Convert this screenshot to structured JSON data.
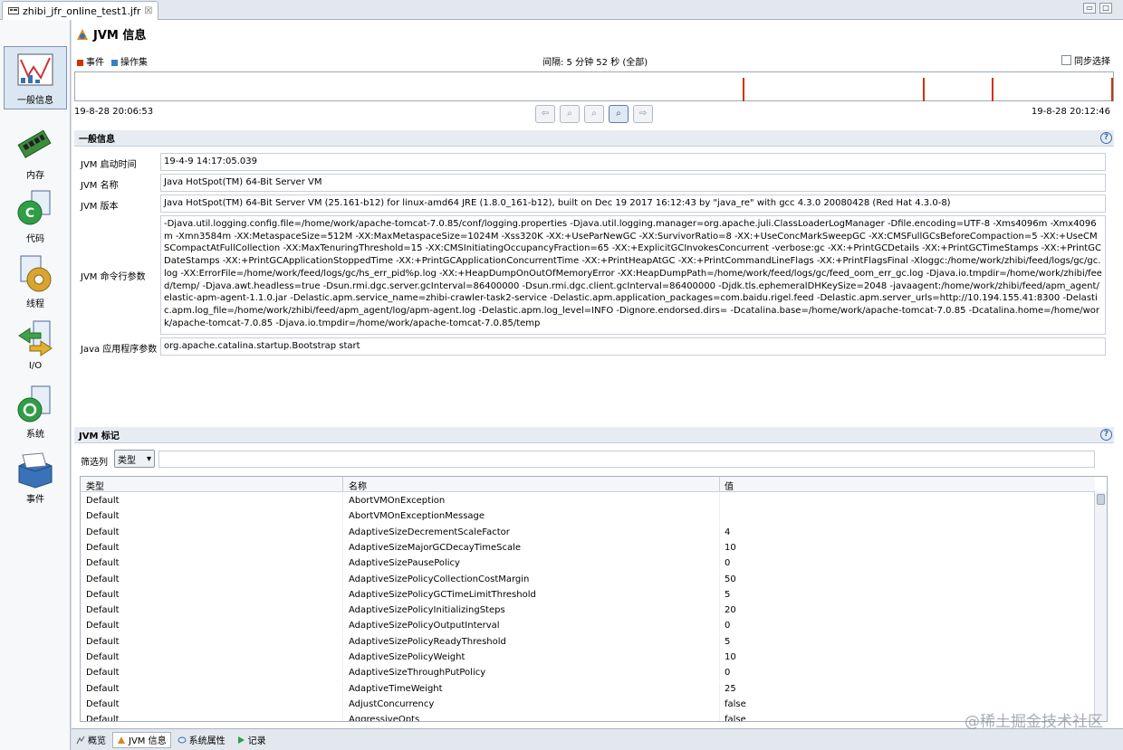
{
  "editor_tab": {
    "title": "zhibi_jfr_online_test1.jfr",
    "close": "☒"
  },
  "window_controls": {
    "minimize": "▭",
    "maximize": "□"
  },
  "sidebar": {
    "items": [
      {
        "label": "一般信息",
        "icon": "general-info-chart-icon",
        "active": true
      },
      {
        "label": "内存",
        "icon": "memory-chip-icon",
        "active": false
      },
      {
        "label": "代码",
        "icon": "code-icon",
        "active": false
      },
      {
        "label": "线程",
        "icon": "threads-gear-icon",
        "active": false
      },
      {
        "label": "I/O",
        "icon": "io-arrows-icon",
        "active": false
      },
      {
        "label": "系统",
        "icon": "system-icon",
        "active": false
      },
      {
        "label": "事件",
        "icon": "events-box-icon",
        "active": false
      }
    ]
  },
  "header": {
    "title": "JVM 信息"
  },
  "timeline": {
    "legend": [
      {
        "label": "事件",
        "color": "#cc3300"
      },
      {
        "label": "操作集",
        "color": "#3a7fc1"
      }
    ],
    "interval": "间隔: 5 分钟 52 秒 (全部)",
    "sync_label": "同步选择",
    "start": "19-8-28 20:06:53",
    "end": "19-8-28 20:12:46",
    "marker_fractions": [
      0.643,
      0.817,
      0.883,
      1.0
    ],
    "zoom_buttons": [
      {
        "glyph": "⇦",
        "on": false
      },
      {
        "glyph": "⌕",
        "on": false
      },
      {
        "glyph": "⌕",
        "on": false
      },
      {
        "glyph": "⌕",
        "on": true
      },
      {
        "glyph": "⇨",
        "on": false
      }
    ]
  },
  "general": {
    "section_title": "一般信息",
    "help": "?",
    "fields": [
      {
        "label": "JVM 启动时间",
        "value": "19-4-9 14:17:05.039"
      },
      {
        "label": "JVM 名称",
        "value": "Java HotSpot(TM) 64-Bit Server VM"
      },
      {
        "label": "JVM 版本",
        "value": "Java HotSpot(TM) 64-Bit Server VM (25.161-b12) for linux-amd64 JRE (1.8.0_161-b12), built on Dec 19 2017 16:12:43 by \"java_re\" with gcc 4.3.0 20080428 (Red Hat 4.3.0-8)"
      },
      {
        "label": "JVM 命令行参数",
        "value": "-Djava.util.logging.config.file=/home/work/apache-tomcat-7.0.85/conf/logging.properties -Djava.util.logging.manager=org.apache.juli.ClassLoaderLogManager -Dfile.encoding=UTF-8 -Xms4096m -Xmx4096m -Xmn3584m -XX:MetaspaceSize=512M -XX:MaxMetaspaceSize=1024M -Xss320K -XX:+UseParNewGC -XX:SurvivorRatio=8 -XX:+UseConcMarkSweepGC -XX:CMSFullGCsBeforeCompaction=5 -XX:+UseCMSCompactAtFullCollection -XX:MaxTenuringThreshold=15 -XX:CMSInitiatingOccupancyFraction=65 -XX:+ExplicitGCInvokesConcurrent -verbose:gc -XX:+PrintGCDetails -XX:+PrintGCTimeStamps -XX:+PrintGCDateStamps -XX:+PrintGCApplicationStoppedTime -XX:+PrintGCApplicationConcurrentTime -XX:+PrintHeapAtGC -XX:+PrintCommandLineFlags -XX:+PrintFlagsFinal -Xloggc:/home/work/zhibi/feed/logs/gc/gc.log -XX:ErrorFile=/home/work/feed/logs/gc/hs_err_pid%p.log -XX:+HeapDumpOnOutOfMemoryError -XX:HeapDumpPath=/home/work/feed/logs/gc/feed_oom_err_gc.log -Djava.io.tmpdir=/home/work/zhibi/feed/temp/ -Djava.awt.headless=true -Dsun.rmi.dgc.server.gcInterval=86400000 -Dsun.rmi.dgc.client.gcInterval=86400000 -Djdk.tls.ephemeralDHKeySize=2048 -javaagent:/home/work/zhibi/feed/apm_agent/elastic-apm-agent-1.1.0.jar -Delastic.apm.service_name=zhibi-crawler-task2-service -Delastic.apm.application_packages=com.baidu.rigel.feed -Delastic.apm.server_urls=http://10.194.155.41:8300 -Delastic.apm.log_file=/home/work/zhibi/feed/apm_agent/log/apm-agent.log -Delastic.apm.log_level=INFO -Dignore.endorsed.dirs= -Dcatalina.base=/home/work/apache-tomcat-7.0.85 -Dcatalina.home=/home/work/apache-tomcat-7.0.85 -Djava.io.tmpdir=/home/work/apache-tomcat-7.0.85/temp"
      },
      {
        "label": "Java 应用程序参数",
        "value": "org.apache.catalina.startup.Bootstrap start"
      }
    ]
  },
  "flags": {
    "section_title": "JVM 标记",
    "help": "?",
    "filter_label": "筛选列",
    "filter_select": "类型",
    "filter_arrow": "▾",
    "columns": [
      "类型",
      "名称",
      "值"
    ],
    "rows": [
      [
        "Default",
        "AbortVMOnException",
        ""
      ],
      [
        "Default",
        "AbortVMOnExceptionMessage",
        ""
      ],
      [
        "Default",
        "AdaptiveSizeDecrementScaleFactor",
        "4"
      ],
      [
        "Default",
        "AdaptiveSizeMajorGCDecayTimeScale",
        "10"
      ],
      [
        "Default",
        "AdaptiveSizePausePolicy",
        "0"
      ],
      [
        "Default",
        "AdaptiveSizePolicyCollectionCostMargin",
        "50"
      ],
      [
        "Default",
        "AdaptiveSizePolicyGCTimeLimitThreshold",
        "5"
      ],
      [
        "Default",
        "AdaptiveSizePolicyInitializingSteps",
        "20"
      ],
      [
        "Default",
        "AdaptiveSizePolicyOutputInterval",
        "0"
      ],
      [
        "Default",
        "AdaptiveSizePolicyReadyThreshold",
        "5"
      ],
      [
        "Default",
        "AdaptiveSizePolicyWeight",
        "10"
      ],
      [
        "Default",
        "AdaptiveSizeThroughPutPolicy",
        "0"
      ],
      [
        "Default",
        "AdaptiveTimeWeight",
        "25"
      ],
      [
        "Default",
        "AdjustConcurrency",
        "false"
      ],
      [
        "Default",
        "AggressiveOpts",
        "false"
      ]
    ]
  },
  "bottom_tabs": [
    {
      "label": "概览",
      "icon": "overview-icon",
      "active": false
    },
    {
      "label": "JVM 信息",
      "icon": "jvm-info-icon",
      "active": true
    },
    {
      "label": "系统属性",
      "icon": "system-properties-icon",
      "active": false
    },
    {
      "label": "记录",
      "icon": "recording-icon",
      "active": false
    }
  ],
  "watermark": "@稀土掘金技术社区"
}
